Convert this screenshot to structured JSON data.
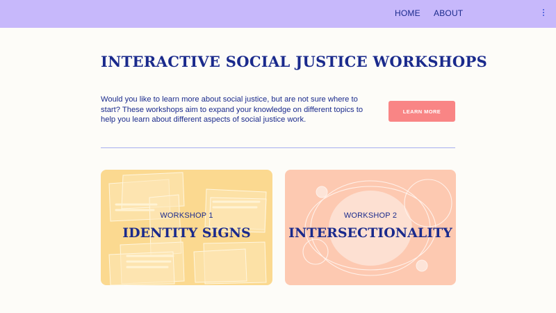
{
  "nav": {
    "home": "HOME",
    "about": "ABOUT",
    "menu_icon": "vertical-dots-icon"
  },
  "hero": {
    "title": "INTERACTIVE SOCIAL JUSTICE WORKSHOPS",
    "intro": "Would you like to learn more about social justice, but are not sure where to start? These workshops aim to expand your knowledge on different topics to help you learn about different aspects of social justice work.",
    "button_label": "LEARN MORE"
  },
  "workshops": [
    {
      "kicker": "WORKSHOP 1",
      "title": "IDENTITY SIGNS"
    },
    {
      "kicker": "WORKSHOP 2",
      "title": "INTERSECTIONALITY"
    }
  ],
  "colors": {
    "topbar": "#c7b8fb",
    "navy": "#1a2a8c",
    "button": "#f98585",
    "card1": "#fbd990",
    "card2": "#fdc9b1",
    "background": "#fdfcf8"
  }
}
